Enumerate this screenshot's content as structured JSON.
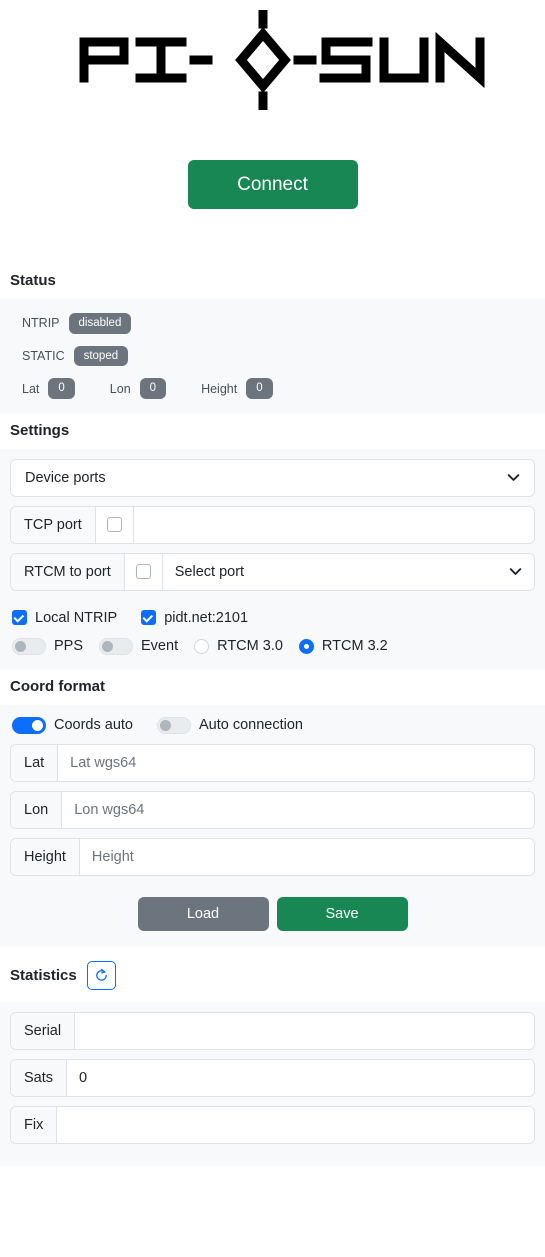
{
  "brand": {
    "logo_text": "PI-◇-SUN",
    "logo_alt": "pi-sun-logo"
  },
  "connect": {
    "label": "Connect"
  },
  "status": {
    "title": "Status",
    "rows": [
      {
        "label": "NTRIP",
        "value": "disabled"
      },
      {
        "label": "STATIC",
        "value": "stoped"
      }
    ],
    "coords": [
      {
        "label": "Lat",
        "value": "0"
      },
      {
        "label": "Lon",
        "value": "0"
      },
      {
        "label": "Height",
        "value": "0"
      }
    ]
  },
  "settings": {
    "title": "Settings",
    "device_ports": {
      "value": "Device ports"
    },
    "tcp_port": {
      "label": "TCP port",
      "checked": false,
      "value": "",
      "placeholder": ""
    },
    "rtcm_to_port": {
      "label": "RTCM to port",
      "checked": false,
      "select_value": "Select port"
    },
    "checks": [
      {
        "label": "Local NTRIP",
        "checked": true
      },
      {
        "label": "pidt.net:2101",
        "checked": true
      }
    ],
    "toggles": [
      {
        "label": "PPS",
        "on": false
      },
      {
        "label": "Event",
        "on": false
      }
    ],
    "radios": [
      {
        "label": "RTCM 3.0",
        "on": false
      },
      {
        "label": "RTCM 3.2",
        "on": true
      }
    ]
  },
  "coord_format": {
    "title": "Coord format",
    "toggles": [
      {
        "label": "Coords auto",
        "on": true
      },
      {
        "label": "Auto connection",
        "on": false
      }
    ],
    "fields": [
      {
        "label": "Lat",
        "value": "",
        "placeholder": "Lat wgs64"
      },
      {
        "label": "Lon",
        "value": "",
        "placeholder": "Lon wgs64"
      },
      {
        "label": "Height",
        "value": "",
        "placeholder": "Height"
      }
    ],
    "buttons": {
      "load": "Load",
      "save": "Save"
    }
  },
  "statistics": {
    "title": "Statistics",
    "refresh_icon": "refresh-icon",
    "fields": [
      {
        "label": "Serial",
        "value": "",
        "placeholder": ""
      },
      {
        "label": "Sats",
        "value": "0",
        "placeholder": ""
      },
      {
        "label": "Fix",
        "value": "",
        "placeholder": ""
      }
    ]
  },
  "colors": {
    "success": "#198754",
    "secondary": "#6c757d",
    "primary": "#0d6efd",
    "panel_bg": "#f8f9fa",
    "border": "#dee2e6"
  }
}
